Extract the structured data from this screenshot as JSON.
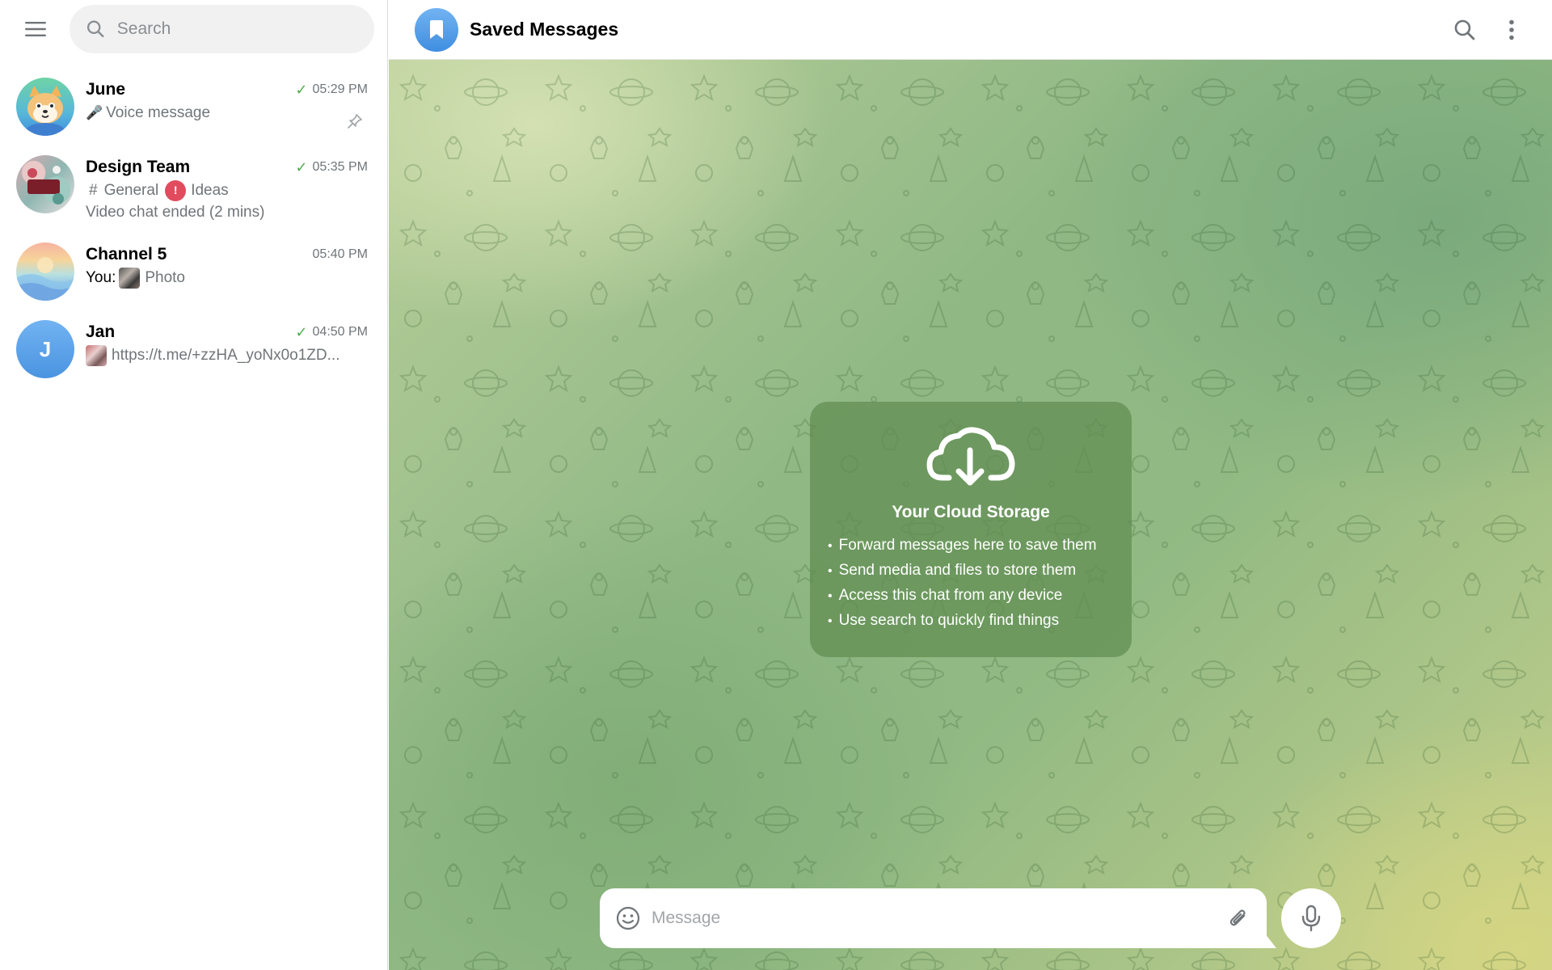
{
  "sidebar": {
    "search_placeholder": "Search",
    "chats": [
      {
        "name": "June",
        "time": "05:29 PM",
        "read": true,
        "preview_icon": "🎤",
        "preview": "Voice message",
        "pinned": true,
        "avatar_type": "shiba-dog-sticker"
      },
      {
        "name": "Design Team",
        "time": "05:35 PM",
        "read": true,
        "topic1": "General",
        "topic2": "Ideas",
        "topic2_badge": "!",
        "preview": "Video chat ended (2 mins)",
        "avatar_type": "floral-photo"
      },
      {
        "name": "Channel 5",
        "time": "05:40 PM",
        "read": false,
        "sender": "You:",
        "preview": "Photo",
        "avatar_type": "pastel-waves"
      },
      {
        "name": "Jan",
        "time": "04:50 PM",
        "read": true,
        "initial": "J",
        "preview": "https://t.me/+zzHA_yoNx0o1ZD...",
        "avatar_type": "initial"
      }
    ]
  },
  "chat": {
    "title": "Saved Messages",
    "empty_state": {
      "title": "Your Cloud Storage",
      "items": [
        "Forward messages here to save them",
        "Send media and files to store them",
        "Access this chat from any device",
        "Use search to quickly find things"
      ]
    },
    "composer_placeholder": "Message"
  },
  "colors": {
    "accent": "#3f8ee0",
    "check_green": "#4fae4e",
    "badge_red": "#e14b5e",
    "card_bg": "#608c50"
  }
}
